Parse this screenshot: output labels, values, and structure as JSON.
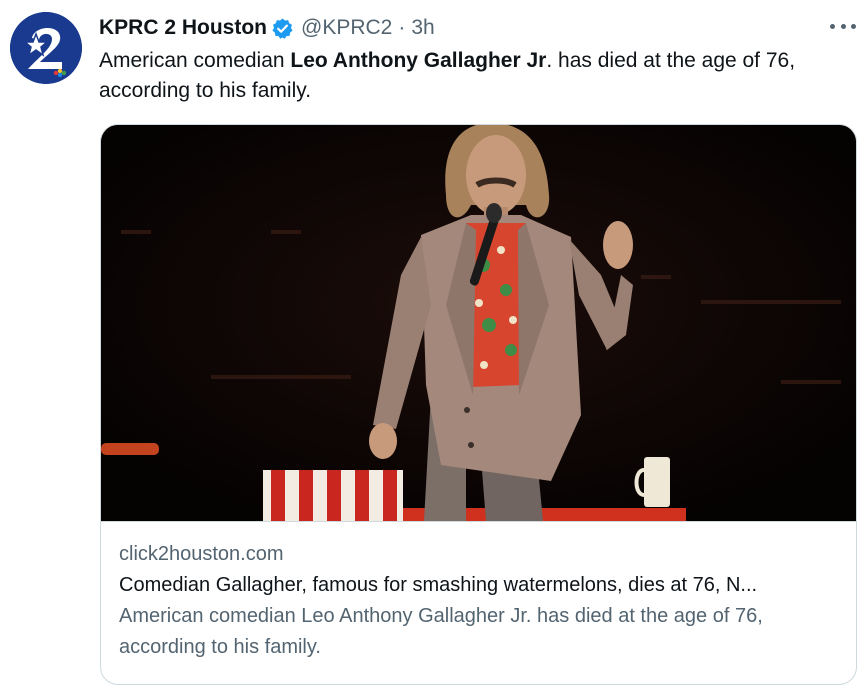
{
  "tweet": {
    "author": {
      "display_name": "KPRC 2 Houston",
      "handle": "@KPRC2",
      "verified": true,
      "avatar_icon": "kprc2-logo-icon",
      "avatar_color": "#1a3a8f"
    },
    "separator": "·",
    "time": "3h",
    "text_before": "American comedian ",
    "text_bold": "Leo Anthony Gallagher Jr",
    "text_after": ". has died at the age of 76, according to his family.",
    "more_icon": "more-options-icon"
  },
  "card": {
    "domain": "click2houston.com",
    "title": "Comedian Gallagher, famous for smashing watermelons, dies at 76, N...",
    "description": "American comedian Leo Anthony Gallagher Jr. has died at the age of 76, according to his family.",
    "image_icon": "article-photo-image"
  },
  "colors": {
    "verified_badge": "#1d9bf0",
    "secondary_text": "#536471",
    "border": "#cfd9de"
  }
}
